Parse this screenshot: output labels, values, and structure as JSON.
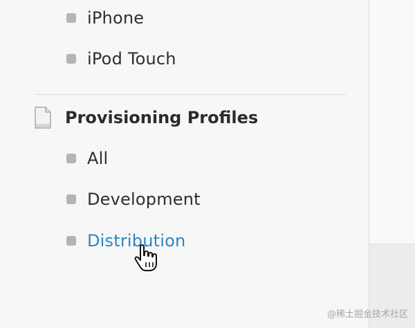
{
  "sidebar": {
    "device_items": [
      {
        "label": "iPhone"
      },
      {
        "label": "iPod Touch"
      }
    ],
    "provisioning": {
      "title": "Provisioning Profiles",
      "icon": "document-icon",
      "items": [
        {
          "label": "All"
        },
        {
          "label": "Development"
        },
        {
          "label": "Distribution",
          "active": true
        }
      ]
    }
  },
  "colors": {
    "active_link": "#2a86c3",
    "bullet": "#b4b4b4",
    "text": "#2e2e2e"
  },
  "cursor": {
    "icon": "hand-pointer-icon"
  },
  "watermark": "@稀土掘金技术社区"
}
